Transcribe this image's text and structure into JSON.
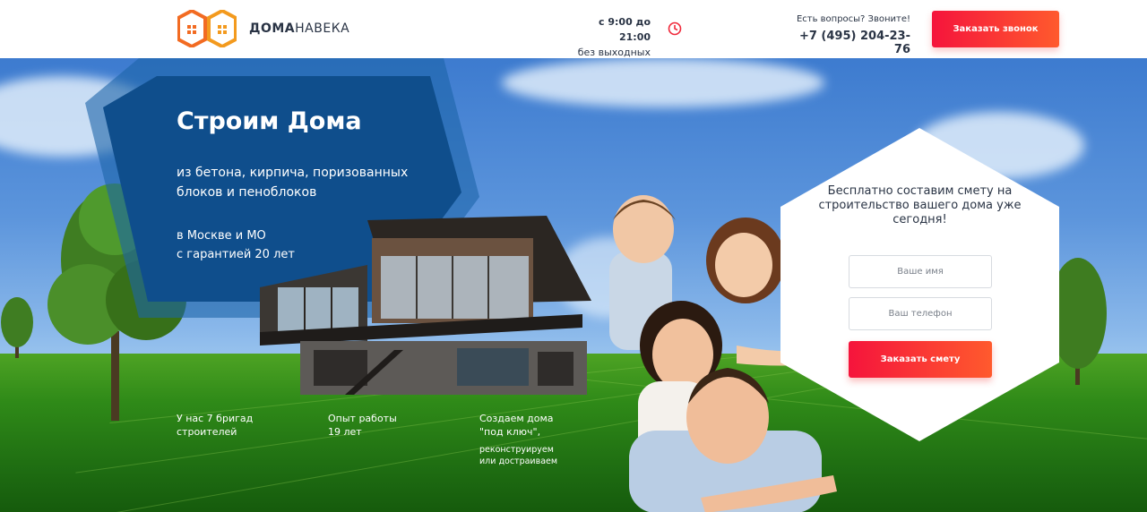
{
  "header": {
    "logo": {
      "bold": "ДОМА",
      "light": "НАВЕКА"
    },
    "hours": {
      "line1": "с 9:00 до 21:00",
      "line2": "без выходных"
    },
    "contact": {
      "question": "Есть вопросы? Звоните!",
      "phone": "+7 (495) 204-23-76"
    },
    "call_button": "Заказать звонок"
  },
  "hero": {
    "title": "Строим Дома",
    "subtitle": "из бетона, кирпича, поризованных блоков и пеноблоков",
    "location": "в Москве и МО",
    "guarantee": "с гарантией 20 лет"
  },
  "features": [
    {
      "line1": "У нас 7 бригад",
      "line2": "строителей"
    },
    {
      "line1": "Опыт работы",
      "line2": "19 лет"
    },
    {
      "line1": "Создаем дома",
      "line2": "\"под ключ\",",
      "extra1": "реконструируем",
      "extra2": "или достраиваем"
    }
  ],
  "form": {
    "title": "Бесплатно составим смету на строительство вашего дома уже сегодня!",
    "name_placeholder": "Ваше имя",
    "phone_placeholder": "Ваш телефон",
    "submit": "Заказать смету"
  },
  "colors": {
    "accent": "#f5143c",
    "accent2": "#ff5a2d",
    "dark_blue": "#0f4e8c",
    "text": "#2a3445",
    "logo_orange": "#f26b22"
  },
  "icons": [
    "house-logo-icon",
    "clock-icon"
  ]
}
